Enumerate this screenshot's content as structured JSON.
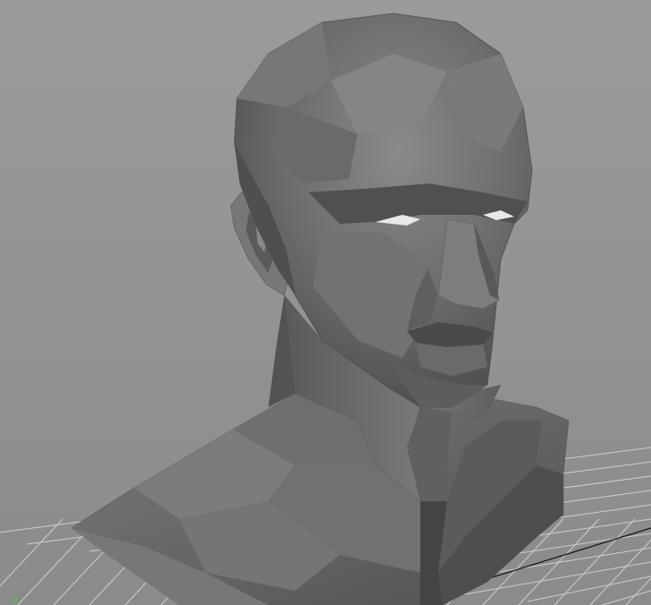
{
  "viewport": {
    "background_color": "#909090",
    "grid_color": "#cfcfcf",
    "axis_color": "#111111",
    "model_color": "#6e6e6e",
    "axis_indicator_color": "#3cd03c"
  },
  "model": {
    "name": "bust",
    "shading": "flat-faceted-gray"
  }
}
